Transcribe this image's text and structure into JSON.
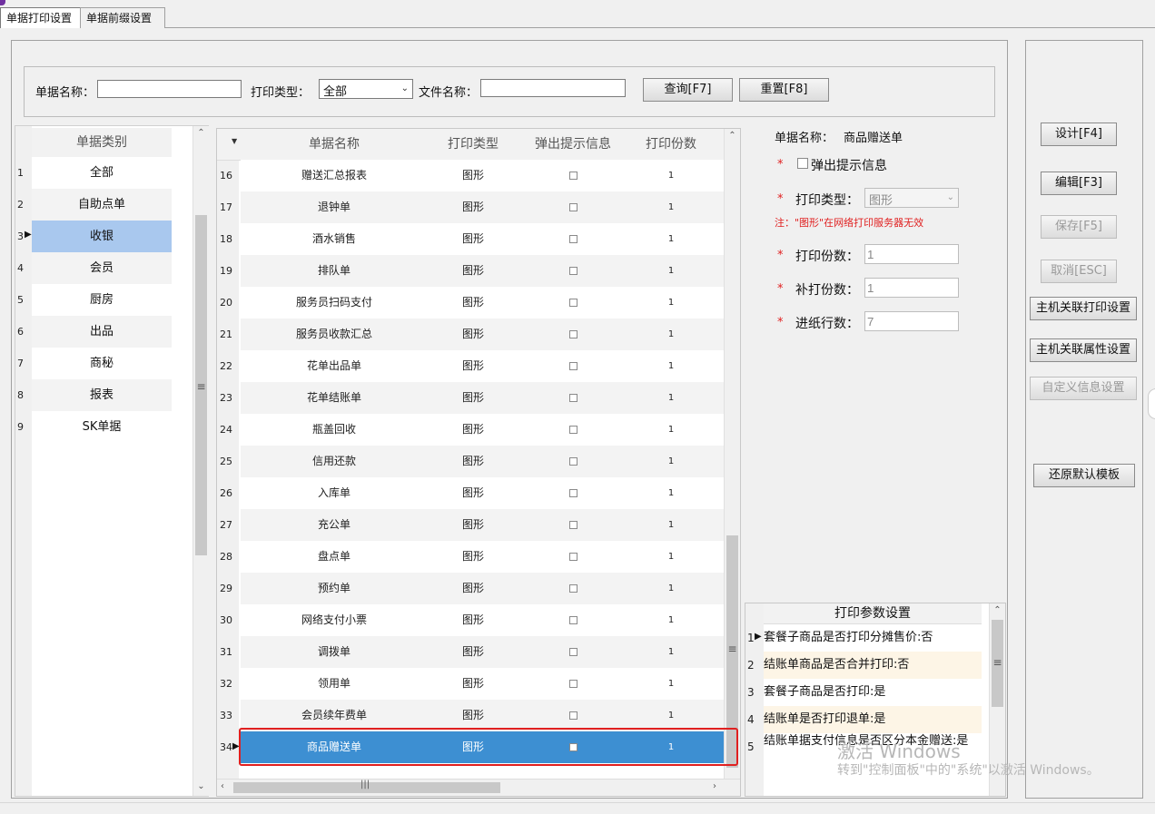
{
  "tabs": [
    {
      "label": "单据打印设置"
    },
    {
      "label": "单据前缀设置"
    }
  ],
  "search": {
    "name_label": "单据名称：",
    "name_value": "",
    "type_label": "打印类型：",
    "type_value": "全部",
    "file_label": "文件名称：",
    "file_value": "",
    "query_button": "查询[F7]",
    "reset_button": "重置[F8]"
  },
  "category": {
    "header": "单据类别",
    "items": [
      {
        "num": "1",
        "label": "全部"
      },
      {
        "num": "2",
        "label": "自助点单"
      },
      {
        "num": "3",
        "label": "收银"
      },
      {
        "num": "4",
        "label": "会员"
      },
      {
        "num": "5",
        "label": "厨房"
      },
      {
        "num": "6",
        "label": "出品"
      },
      {
        "num": "7",
        "label": "商秘"
      },
      {
        "num": "8",
        "label": "报表"
      },
      {
        "num": "9",
        "label": "SK单据"
      }
    ],
    "selected_index": 2
  },
  "bills": {
    "headers": {
      "name": "单据名称",
      "type": "打印类型",
      "popup": "弹出提示信息",
      "copies": "打印份数"
    },
    "rows": [
      {
        "num": "16",
        "name": "赠送汇总报表",
        "type": "图形",
        "copies": "1"
      },
      {
        "num": "17",
        "name": "退钟单",
        "type": "图形",
        "copies": "1"
      },
      {
        "num": "18",
        "name": "酒水销售",
        "type": "图形",
        "copies": "1"
      },
      {
        "num": "19",
        "name": "排队单",
        "type": "图形",
        "copies": "1"
      },
      {
        "num": "20",
        "name": "服务员扫码支付",
        "type": "图形",
        "copies": "1"
      },
      {
        "num": "21",
        "name": "服务员收款汇总",
        "type": "图形",
        "copies": "1"
      },
      {
        "num": "22",
        "name": "花单出品单",
        "type": "图形",
        "copies": "1"
      },
      {
        "num": "23",
        "name": "花单结账单",
        "type": "图形",
        "copies": "1"
      },
      {
        "num": "24",
        "name": "瓶盖回收",
        "type": "图形",
        "copies": "1"
      },
      {
        "num": "25",
        "name": "信用还款",
        "type": "图形",
        "copies": "1"
      },
      {
        "num": "26",
        "name": "入库单",
        "type": "图形",
        "copies": "1"
      },
      {
        "num": "27",
        "name": "充公单",
        "type": "图形",
        "copies": "1"
      },
      {
        "num": "28",
        "name": "盘点单",
        "type": "图形",
        "copies": "1"
      },
      {
        "num": "29",
        "name": "预约单",
        "type": "图形",
        "copies": "1"
      },
      {
        "num": "30",
        "name": "网络支付小票",
        "type": "图形",
        "copies": "1"
      },
      {
        "num": "31",
        "name": "调拨单",
        "type": "图形",
        "copies": "1"
      },
      {
        "num": "32",
        "name": "领用单",
        "type": "图形",
        "copies": "1"
      },
      {
        "num": "33",
        "name": "会员续年费单",
        "type": "图形",
        "copies": "1"
      },
      {
        "num": "34",
        "name": "商品赠送单",
        "type": "图形",
        "copies": "1"
      }
    ],
    "selected_index": 18
  },
  "detail": {
    "bill_name_label": "单据名称：",
    "bill_name_value": "商品赠送单",
    "required_mark": "*",
    "popup_label": "弹出提示信息",
    "print_type_label": "打印类型：",
    "print_type_value": "图形",
    "note": "注：\"图形\"在网络打印服务器无效",
    "copies_label": "打印份数：",
    "copies_value": "1",
    "reprint_label": "补打份数：",
    "reprint_value": "1",
    "feed_label": "进纸行数：",
    "feed_value": "7"
  },
  "params": {
    "header": "打印参数设置",
    "items": [
      {
        "num": "1",
        "text": "套餐子商品是否打印分摊售价:否"
      },
      {
        "num": "2",
        "text": "结账单商品是否合并打印:否"
      },
      {
        "num": "3",
        "text": "套餐子商品是否打印:是"
      },
      {
        "num": "4",
        "text": "结账单是否打印退单:是"
      },
      {
        "num": "5",
        "text": "结账单据支付信息是否区分本金赠送:是"
      }
    ]
  },
  "actions": {
    "design": "设计[F4]",
    "edit": "编辑[F3]",
    "save": "保存[F5]",
    "cancel": "取消[ESC]",
    "host_print": "主机关联打印设置",
    "host_attr": "主机关联属性设置",
    "custom_info": "自定义信息设置",
    "restore": "还原默认模板"
  },
  "watermark": {
    "line1": "激活 Windows",
    "line2": "转到\"控制面板\"中的\"系统\"以激活 Windows。"
  },
  "colors": {
    "selected_row": "#3d8fd2",
    "highlight_box": "#e02020",
    "category_selected": "#a9c8ee"
  }
}
